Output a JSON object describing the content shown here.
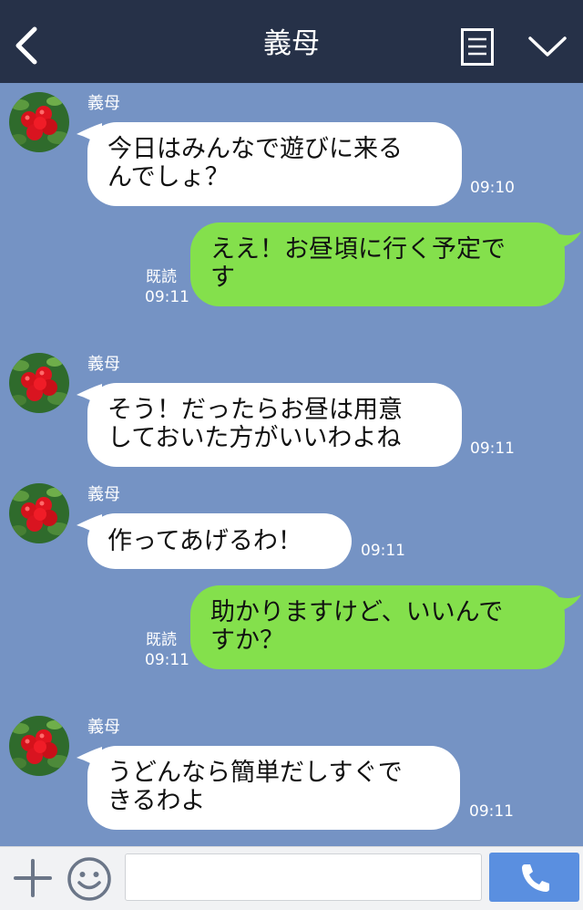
{
  "header": {
    "title": "義母"
  },
  "messages": [
    {
      "sender": "義母",
      "text": "今日はみんなで遊びに来る\nんでしょ？",
      "time": "09:10"
    },
    {
      "read": "既読",
      "text": "ええ！お昼頃に行く予定で\nす",
      "time": "09:11"
    },
    {
      "sender": "義母",
      "text": "そう！だったらお昼は用意\nしておいた方がいいわよね",
      "time": "09:11"
    },
    {
      "sender": "義母",
      "text": "作ってあげるわ！",
      "time": "09:11"
    },
    {
      "read": "既読",
      "text": "助かりますけど、いいんで\nすか？",
      "time": "09:11"
    },
    {
      "sender": "義母",
      "text": "うどんなら簡単だしすぐで\nきるわよ",
      "time": "09:11"
    }
  ],
  "footer": {
    "input_placeholder": ""
  },
  "colors": {
    "header_bg": "#263148",
    "chat_bg": "#7593c4",
    "incoming_bubble": "#ffffff",
    "outgoing_bubble": "#84e04c",
    "send_button": "#5a8fe0"
  },
  "icons": {
    "back": "chevron-left-icon",
    "menu": "note-menu-icon",
    "collapse": "chevron-down-icon",
    "plus": "plus-icon",
    "emoji": "smiley-icon",
    "call": "phone-icon"
  }
}
